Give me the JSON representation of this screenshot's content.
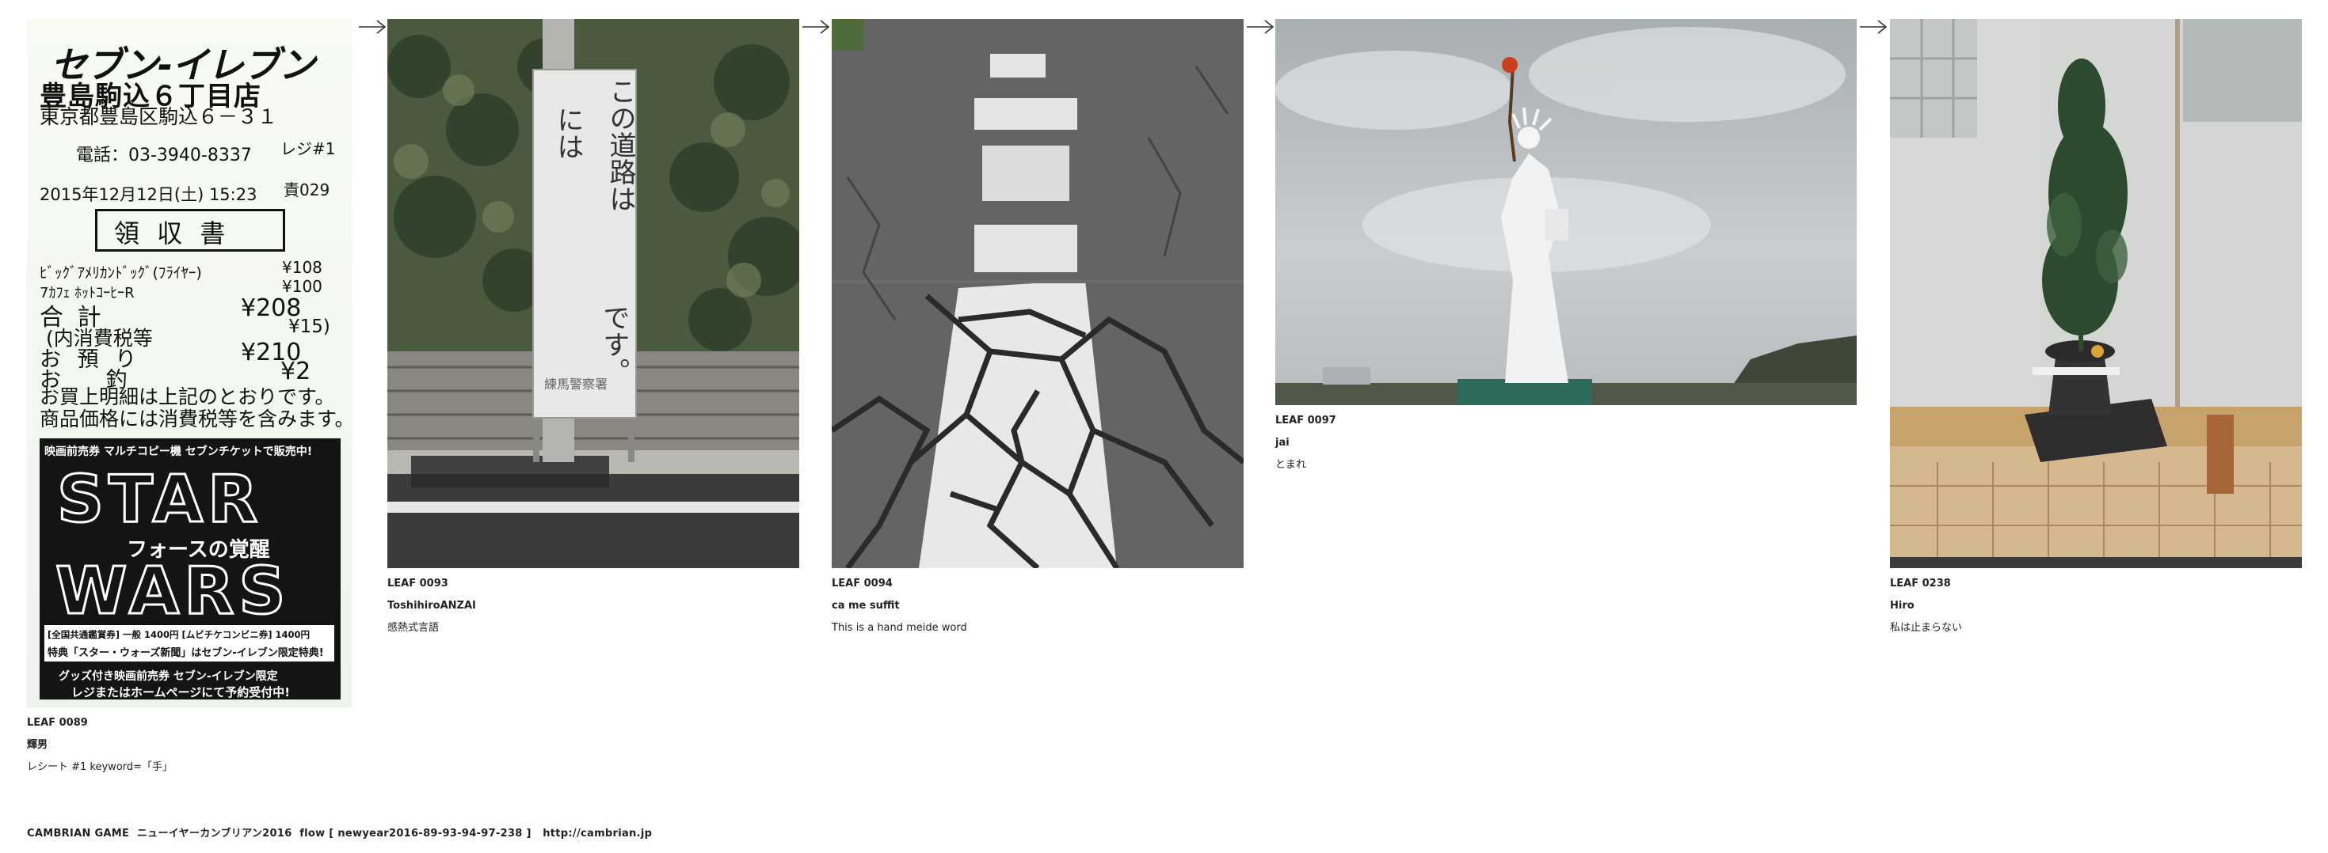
{
  "flow": [
    {
      "leaf": "LEAF 0089",
      "author": "輝男",
      "title": "レシート #1 keyword=「手」",
      "receipt": {
        "store_brand": "セブン-イレブン",
        "store_branch": "豊島駒込６丁目店",
        "address": "東京都豊島区駒込６－３１",
        "phone": "電話：03-3940-8337",
        "register": "レジ#1",
        "datetime": "2015年12月12日(土) 15:23",
        "clerk": "責029",
        "heading": "領 収 書",
        "items": [
          {
            "name": "ﾋﾞｯｸﾞｱﾒﾘｶﾝﾄﾞｯｸﾞ(ﾌﾗｲﾔｰ)",
            "price": "¥108"
          },
          {
            "name": "7ｶﾌｪ ﾎｯﾄｺｰﾋｰR",
            "price": "¥100"
          }
        ],
        "total_label": "合 計",
        "total": "¥208",
        "tax_label": "(内消費税等",
        "tax": "¥15)",
        "paid_label": "お 預 り",
        "paid": "¥210",
        "change_label": "お 釣",
        "change": "¥2",
        "note1": "お買上明細は上記のとおりです。",
        "note2": "商品価格には消費税等を含みます。",
        "ad_top": "映画前売券 マルチコピー機 セブンチケットで販売中!",
        "ad_star": "STAR",
        "ad_subtitle": "フォースの覚醒",
        "ad_wars": "WARS",
        "ad_price1": "[全国共通鑑賞券] 一般 1400円 [ムビチケコンビニ券] 1400円",
        "ad_price2": "特典「スター・ウォーズ新聞」はセブン-イレブン限定特典!",
        "ad_goods": "グッズ付き映画前売券 セブン-イレブン限定",
        "ad_bottom": "レジまたはホームページにて予約受付中!"
      }
    },
    {
      "leaf": "LEAF 0093",
      "author": "ToshihiroANZAI",
      "title": "感熱式言語",
      "sign": {
        "line_main": "この道路は",
        "line_left": "には",
        "line_end": "です。",
        "police": "練馬警察署"
      }
    },
    {
      "leaf": "LEAF 0094",
      "author": "ca me suffit",
      "title": "This is a hand meide word"
    },
    {
      "leaf": "LEAF 0097",
      "author": "jai",
      "title": "とまれ"
    },
    {
      "leaf": "LEAF 0238",
      "author": "Hiro",
      "title": "私は止まらない"
    }
  ],
  "footer": {
    "text": "CAMBRIAN GAME  ニューイヤーカンブリアン2016  flow [ newyear2016-89-93-94-97-238 ]   ",
    "url": "http://cambrian.jp"
  },
  "icons": {
    "arrow": "right-arrow-icon"
  }
}
